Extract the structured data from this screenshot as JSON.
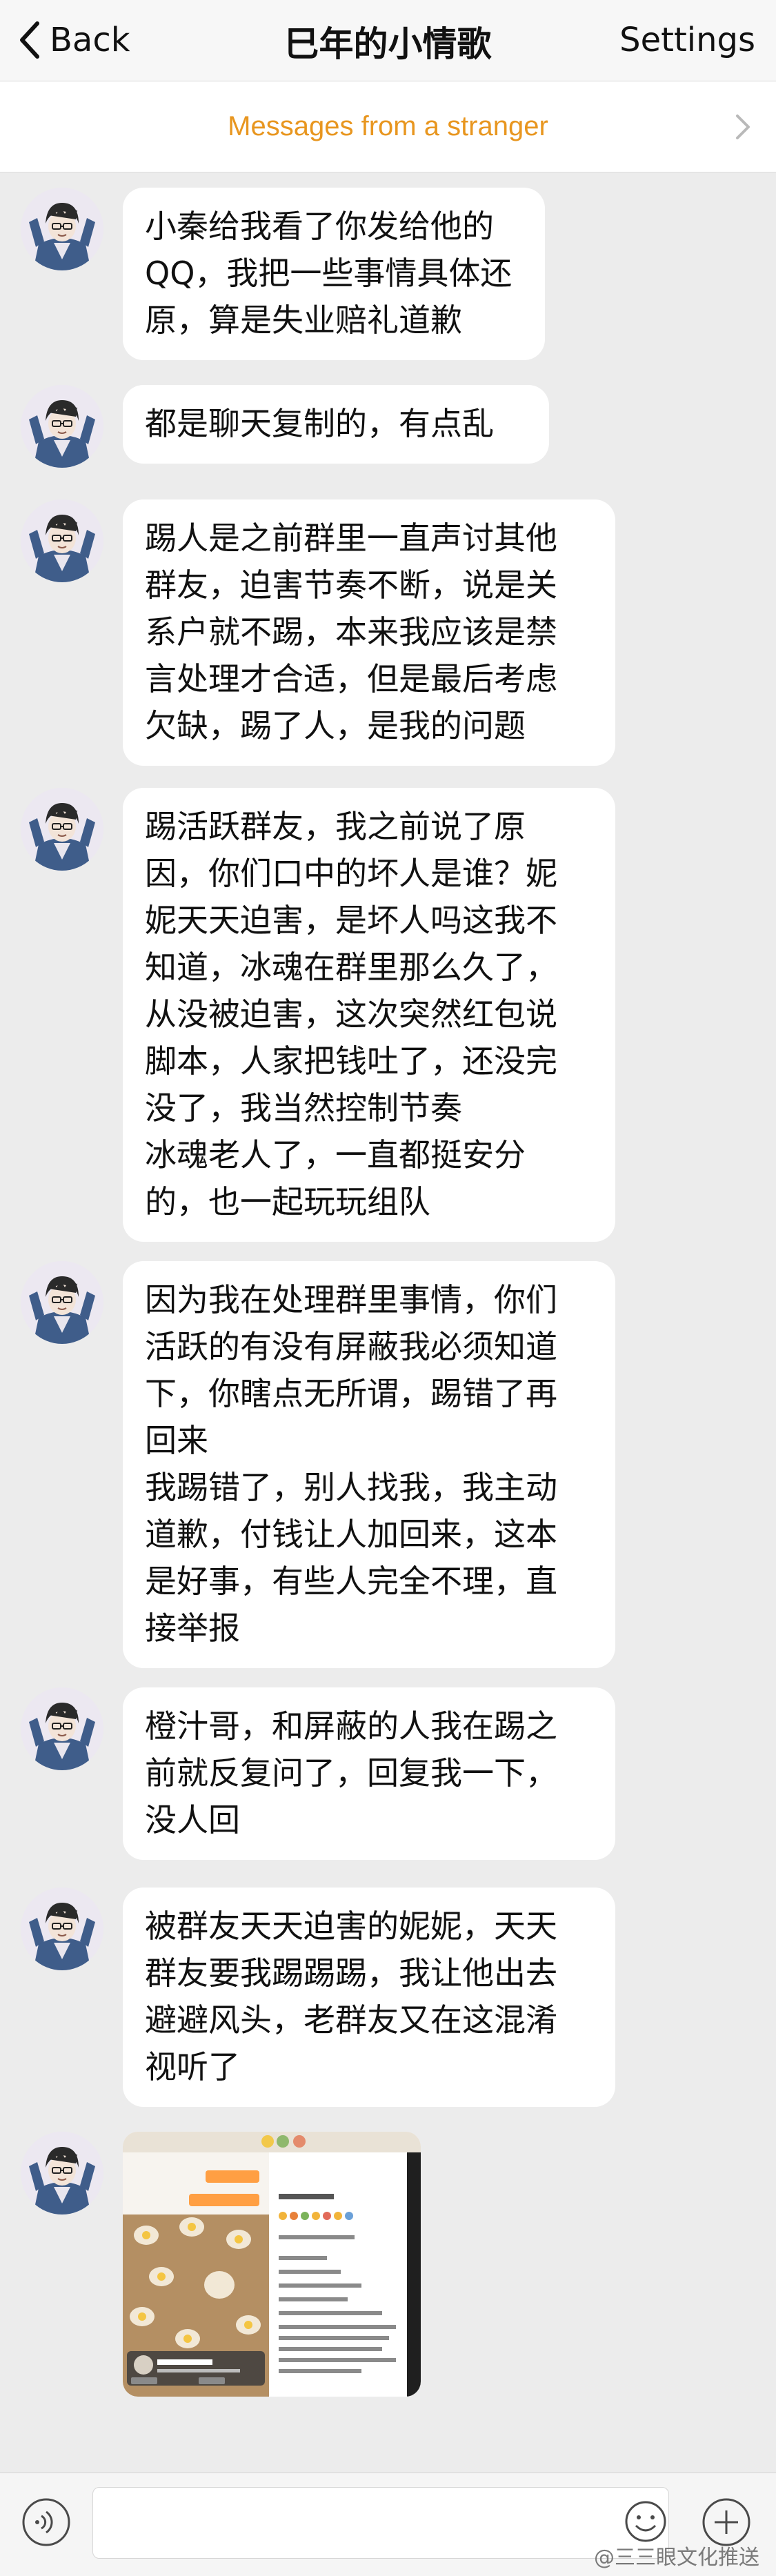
{
  "nav": {
    "back_label": "Back",
    "title": "巳年的小情歌",
    "settings_label": "Settings"
  },
  "banner": {
    "label": "Messages from a stranger"
  },
  "messages": [
    {
      "text": "小秦给我看了你发给他的\nQQ，我把一些事情具体还\n原，算是失业赔礼道歉"
    },
    {
      "text": "都是聊天复制的，有点乱"
    },
    {
      "text": "踢人是之前群里一直声讨其他\n群友，迫害节奏不断，说是关\n系户就不踢，本来我应该是禁\n言处理才合适，但是最后考虑\n欠缺，踢了人，是我的问题"
    },
    {
      "text": "踢活跃群友，我之前说了原\n因，你们口中的坏人是谁？妮\n妮天天迫害，是坏人吗这我不\n知道，冰魂在群里那么久了，\n从没被迫害，这次突然红包说\n脚本，人家把钱吐了，还没完\n没了，我当然控制节奏\n冰魂老人了，一直都挺安分\n的，也一起玩玩组队"
    },
    {
      "text": "因为我在处理群里事情，你们\n活跃的有没有屏蔽我必须知道\n下，你瞎点无所谓，踢错了再\n回来\n我踢错了，别人找我，我主动\n道歉，付钱让人加回来，这本\n是好事，有些人完全不理，直\n接举报"
    },
    {
      "text": "橙汁哥，和屏蔽的人我在踢之\n前就反复问了，回复我一下，\n没人回"
    },
    {
      "text": "被群友天天迫害的妮妮，天天\n群友要我踢踢踢，我让他出去\n避避风头，老群友又在这混淆\n视听了"
    }
  ],
  "image_message": {
    "label": "chat-screenshot-image"
  },
  "input": {
    "placeholder": ""
  },
  "watermark": "@三三眼文化推送",
  "colors": {
    "banner_text": "#e8961f",
    "page_bg": "#ececec",
    "bubble_bg": "#ffffff"
  }
}
